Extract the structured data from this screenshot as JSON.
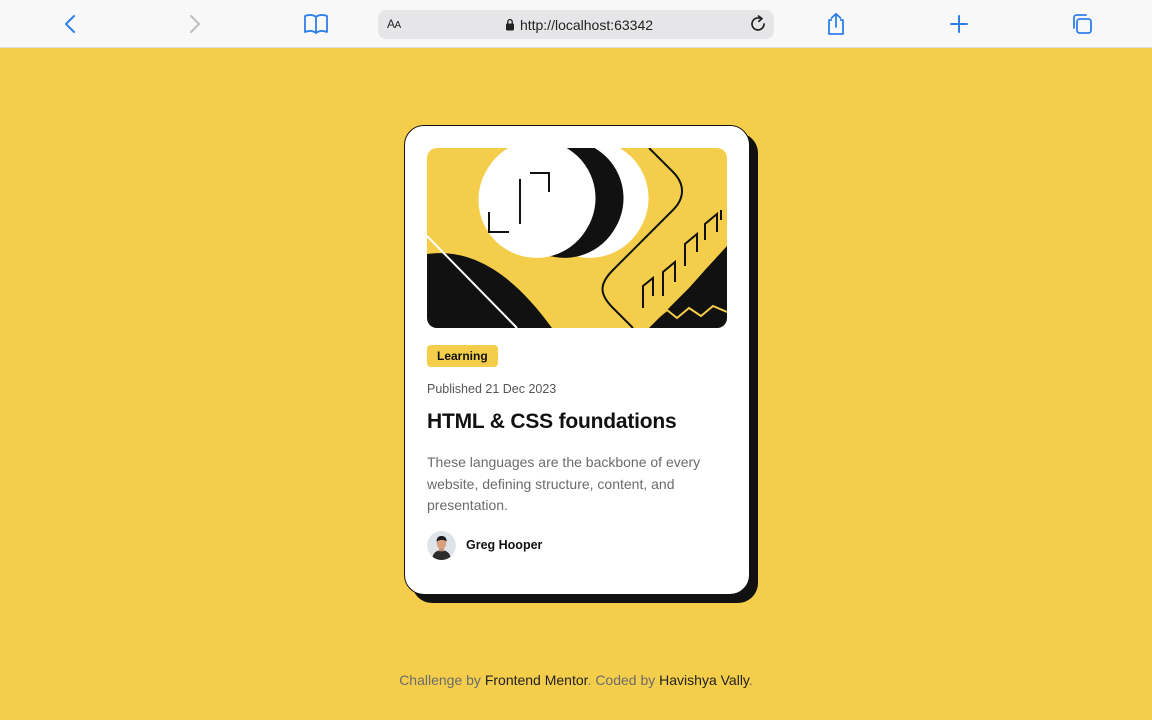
{
  "browser": {
    "text_size_label_big": "A",
    "text_size_label_small": "A",
    "url": "http://localhost:63342"
  },
  "card": {
    "image_alt": "illustration-article",
    "tag": "Learning",
    "published": "Published 21 Dec 2023",
    "title": "HTML & CSS foundations",
    "description": "These languages are the backbone of every website, defining structure, content, and presentation.",
    "author": "Greg Hooper"
  },
  "attribution": {
    "prefix": "Challenge by ",
    "link1": "Frontend Mentor",
    "middle": ". Coded by ",
    "link2": "Havishya Vally",
    "suffix": "."
  },
  "colors": {
    "background": "#f4ce4b",
    "card": "#ffffff",
    "ink": "#111111",
    "accent": "#f4ce4b",
    "browser_icon": "#2f7fe8"
  },
  "icons": [
    "back-icon",
    "forward-icon",
    "bookmarks-icon",
    "lock-icon",
    "reload-icon",
    "share-icon",
    "new-tab-icon",
    "tabs-icon"
  ]
}
